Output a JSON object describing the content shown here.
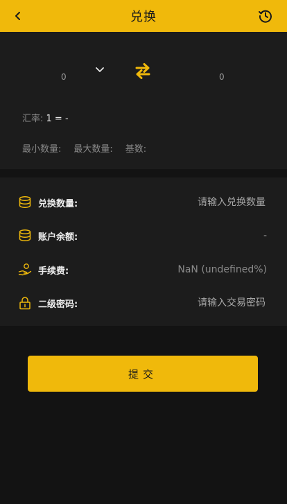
{
  "header": {
    "title": "兑换",
    "back_icon": "chevron-left-icon",
    "history_icon": "history-clock-icon"
  },
  "exchange": {
    "from_value": "0",
    "to_value": "0",
    "swap_icon": "swap-arrows-icon",
    "dropdown_icon": "chevron-down-icon",
    "rate_label": "汇率:",
    "rate_value": "1 = -",
    "min_label": "最小数量:",
    "max_label": "最大数量:",
    "base_label": "基数:"
  },
  "form": {
    "amount": {
      "label": "兑换数量:",
      "placeholder": "请输入兑换数量",
      "icon": "coins-stack-icon"
    },
    "balance": {
      "label": "账户余额:",
      "value": "-",
      "icon": "coins-stack-icon"
    },
    "fee": {
      "label": "手续费:",
      "value": "NaN (undefined%)",
      "icon": "hand-coin-icon"
    },
    "password": {
      "label": "二级密码:",
      "placeholder": "请输入交易密码",
      "icon": "lock-icon"
    }
  },
  "submit": {
    "label": "提交"
  },
  "colors": {
    "accent": "#f0b90b",
    "background": "#131313",
    "panel": "#1c1c1c"
  }
}
